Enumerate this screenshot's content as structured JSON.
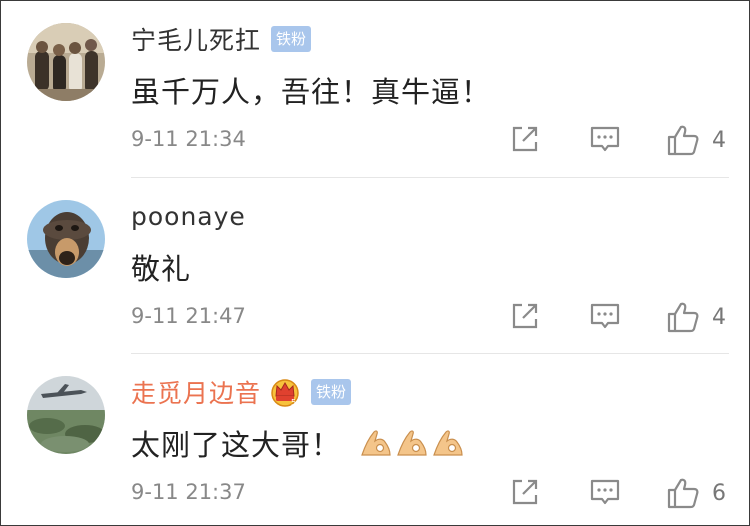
{
  "comments": [
    {
      "username": "宁毛儿死扛",
      "badge": "铁粉",
      "text": "虽千万人，吾往！真牛逼！",
      "time": "9-11 21:34",
      "likes": "4"
    },
    {
      "username": "poonaye",
      "text": "敬礼",
      "time": "9-11 21:47",
      "likes": "4"
    },
    {
      "username": "走觅月边音",
      "badge": "铁粉",
      "text": "太刚了这大哥！",
      "emoji_count": 3,
      "time": "9-11 21:37",
      "likes": "6"
    }
  ],
  "colors": {
    "username": "#333333",
    "vip_username": "#eb7350",
    "badge_bg": "#a9c6ec",
    "meta": "#888888",
    "icon": "#8a8a8a"
  },
  "icons": [
    "repost-icon",
    "comment-icon",
    "like-icon",
    "crown-icon",
    "ok-hand-emoji"
  ]
}
